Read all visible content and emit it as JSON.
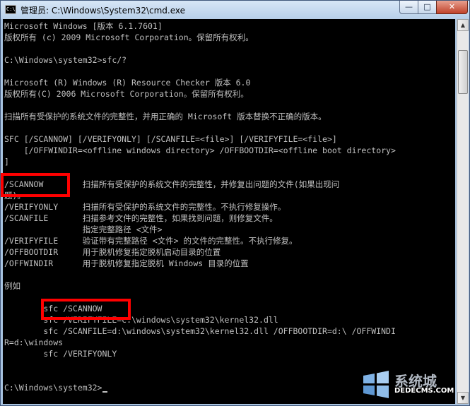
{
  "window": {
    "title": "管理员: C:\\Windows\\System32\\cmd.exe",
    "icon_label": "C:\\",
    "minimize_glyph": "—",
    "maximize_glyph": "□",
    "close_glyph": "✕"
  },
  "console": {
    "lines": [
      "Microsoft Windows [版本 6.1.7601]",
      "版权所有 (c) 2009 Microsoft Corporation。保留所有权利。",
      "",
      "C:\\Windows\\system32>sfc/?",
      "",
      "Microsoft (R) Windows (R) Resource Checker 版本 6.0",
      "版权所有(C) 2006 Microsoft Corporation。保留所有权利。",
      "",
      "扫描所有受保护的系统文件的完整性，并用正确的 Microsoft 版本替换不正确的版本。",
      "",
      "SFC [/SCANNOW] [/VERIFYONLY] [/SCANFILE=<file>] [/VERIFYFILE=<file>]",
      "    [/OFFWINDIR=<offline windows directory> /OFFBOOTDIR=<offline boot directory>",
      "]",
      "",
      "/SCANNOW        扫描所有受保护的系统文件的完整性，并修复出问题的文件(如果出现问",
      "题)。",
      "/VERIFYONLY     扫描所有受保护的系统文件的完整性。不执行修复操作。",
      "/SCANFILE       扫描参考文件的完整性，如果找到问题，则修复文件。",
      "                指定完整路径 <文件>",
      "/VERIFYFILE     验证带有完整路径 <文件> 的文件的完整性。不执行修复。",
      "/OFFBOOTDIR     用于脱机修复指定脱机启动目录的位置",
      "/OFFWINDIR      用于脱机修复指定脱机 Windows 目录的位置",
      "",
      "例如",
      "",
      "        sfc /SCANNOW",
      "        sfc /VERIFYFILE=c:\\windows\\system32\\kernel32.dll",
      "        sfc /SCANFILE=d:\\windows\\system32\\kernel32.dll /OFFBOOTDIR=d:\\ /OFFWINDI",
      "R=d:\\windows",
      "        sfc /VERIFYONLY",
      "",
      "",
      "C:\\Windows\\system32>"
    ]
  },
  "watermark": {
    "title": "系统城",
    "subtitle": "DEDECMS.COM"
  },
  "colors": {
    "console_bg": "#000000",
    "console_text": "#c0c0c0",
    "highlight": "#ff0000",
    "titlebar": "#b7cfe9"
  }
}
